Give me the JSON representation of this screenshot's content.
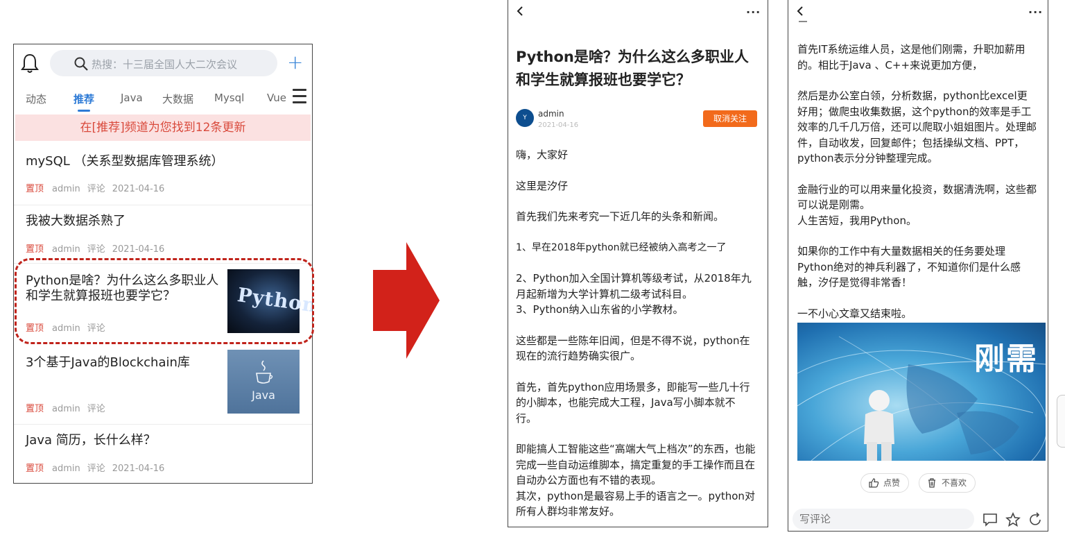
{
  "feed": {
    "search_placeholder": "热搜：十三届全国人大二次会议",
    "tabs": [
      "动态",
      "推荐",
      "Java",
      "大数据",
      "Mysql",
      "Vue"
    ],
    "notice": "在[推荐]频道为您找到12条更新",
    "items": [
      {
        "title": "mySQL （关系型数据库管理系统）",
        "pin": "置顶",
        "author": "admin",
        "comment": "评论",
        "date": "2021-04-16"
      },
      {
        "title": "我被大数据杀熟了",
        "pin": "置顶",
        "author": "admin",
        "comment": "评论",
        "date": "2021-04-16"
      },
      {
        "title": "Python是啥？为什么这么多职业人和学生就算报班也要学它？",
        "pin": "置顶",
        "author": "admin",
        "comment": "评论",
        "thumb_text": "Python"
      },
      {
        "title": "3个基于Java的Blockchain库",
        "pin": "置顶",
        "author": "admin",
        "comment": "评论",
        "thumb_text": "Java"
      },
      {
        "title": "Java 简历，长什么样？",
        "pin": "置顶",
        "author": "admin",
        "comment": "评论",
        "date": "2021-04-16"
      }
    ]
  },
  "article": {
    "title": "Python是啥？为什么这么多职业人和学生就算报班也要学它？",
    "more": "···",
    "author": "admin",
    "date": "2021-04-16",
    "avatar_text": "Y",
    "follow": "取消关注",
    "paragraphs": [
      "嗨，大家好",
      "这里是汐仔",
      "首先我们先来考究一下近几年的头条和新闻。",
      "1、早在2018年python就已经被纳入高考之一了",
      "2、Python加入全国计算机等级考试，从2018年九月起新增为大学计算机二级考试科目。",
      "3、Python纳入山东省的小学教材。",
      "这些都是一些陈年旧闻，但是不得不说，python在现在的流行趋势确实很广。",
      "首先，首先python应用场景多，即能写一些几十行的小脚本，也能完成大工程，Java写小脚本就不行。",
      "即能搞人工智能这些“高端大气上档次”的东西，也能完成一些自动运维脚本，搞定重复的手工操作而且在自动办公方面也有不错的表现。",
      "其次，python是最容易上手的语言之一。python对所有人群均非常友好。"
    ]
  },
  "article_end": {
    "more": "···",
    "paragraphs": [
      "首先IT系统运维人员，这是他们刚需，升职加薪用的。相比于Java 、C++来说更加方便，",
      "然后是办公室白领，分析数据，python比excel更好用；做爬虫收集数据，这个python的效率是手工效率的几千几万倍，还可以爬取小姐姐图片。处理邮件，自动收发，回复邮件；包括操纵文档、PPT，python表示分分钟整理完成。",
      "金融行业的可以用来量化投资，数据清洗啊，这些都可以说是刚需。",
      "人生苦短，我用Python。",
      "如果你的工作中有大量数据相关的任务要处理Python绝对的神兵利器了，不知道你们是什么感触，汐仔是觉得非常香！",
      "一不小心文章又结束啦。"
    ],
    "banner_text": "刚需",
    "like": "点赞",
    "dislike": "不喜欢",
    "comment_placeholder": "写评论"
  },
  "colors": {
    "accent_blue": "#2e7bd6",
    "pin_red": "#d94a3c",
    "follow_orange": "#f26a1b",
    "arrow_red": "#d2221a"
  }
}
